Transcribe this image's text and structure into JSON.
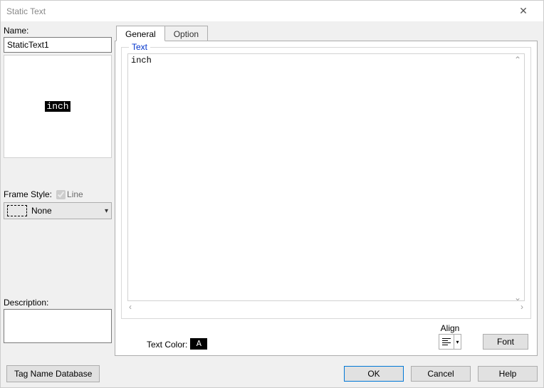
{
  "window": {
    "title": "Static Text"
  },
  "left": {
    "name_label": "Name:",
    "name_value": "StaticText1",
    "preview_text": "inch",
    "frame_style_label": "Frame Style:",
    "line_checkbox_label": "Line",
    "frame_value": "None",
    "description_label": "Description:",
    "description_value": ""
  },
  "tabs": {
    "general": "General",
    "option": "Option"
  },
  "general": {
    "group_legend": "Text",
    "text_value": "inch",
    "text_color_label": "Text Color:",
    "text_color_swatch_char": "A",
    "align_label": "Align",
    "font_button": "Font"
  },
  "footer": {
    "tag_db": "Tag Name Database",
    "ok": "OK",
    "cancel": "Cancel",
    "help": "Help"
  }
}
